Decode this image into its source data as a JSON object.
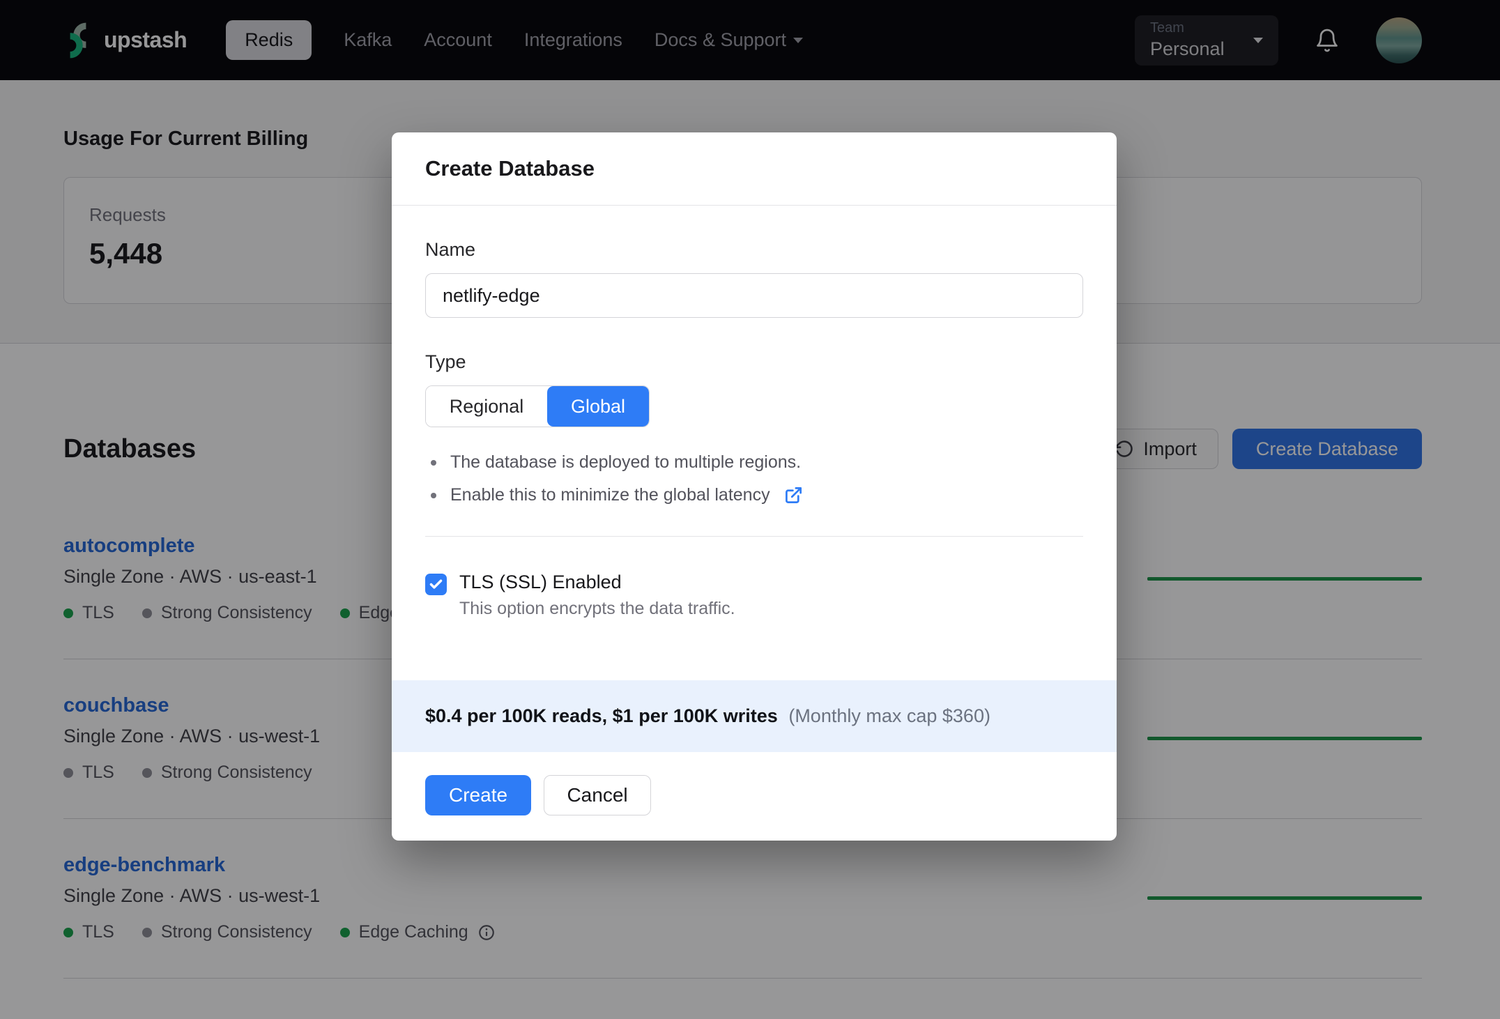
{
  "nav": {
    "brand": "upstash",
    "items": [
      {
        "label": "Redis"
      },
      {
        "label": "Kafka"
      },
      {
        "label": "Account"
      },
      {
        "label": "Integrations"
      },
      {
        "label": "Docs & Support"
      }
    ],
    "team": {
      "label": "Team",
      "value": "Personal"
    }
  },
  "billing": {
    "heading": "Usage For Current Billing",
    "requests_label": "Requests",
    "requests_value": "5,448"
  },
  "databases": {
    "heading": "Databases",
    "import_label": "Import",
    "create_label": "Create Database",
    "rows": [
      {
        "name": "autocomplete",
        "meta": "Single Zone · AWS · us-east-1",
        "badges": [
          {
            "label": "TLS",
            "state": "on"
          },
          {
            "label": "Strong Consistency",
            "state": "off"
          },
          {
            "label": "Edge Caching",
            "state": "on"
          }
        ]
      },
      {
        "name": "couchbase",
        "meta": "Single Zone · AWS · us-west-1",
        "badges": [
          {
            "label": "TLS",
            "state": "off"
          },
          {
            "label": "Strong Consistency",
            "state": "off"
          }
        ]
      },
      {
        "name": "edge-benchmark",
        "meta": "Single Zone · AWS · us-west-1",
        "badges": [
          {
            "label": "TLS",
            "state": "on"
          },
          {
            "label": "Strong Consistency",
            "state": "off"
          },
          {
            "label": "Edge Caching",
            "state": "on"
          }
        ]
      }
    ]
  },
  "modal": {
    "title": "Create Database",
    "name_label": "Name",
    "name_value": "netlify-edge",
    "type_label": "Type",
    "type_options": [
      {
        "label": "Regional"
      },
      {
        "label": "Global"
      }
    ],
    "type_selected": "Global",
    "bullets": [
      "The database is deployed to multiple regions.",
      "Enable this to minimize the global latency"
    ],
    "tls_label": "TLS (SSL) Enabled",
    "tls_desc": "This option encrypts the data traffic.",
    "pricing_bold": "$0.4 per 100K reads, $1 per 100K writes",
    "pricing_muted": "(Monthly max cap $360)",
    "create_label": "Create",
    "cancel_label": "Cancel"
  },
  "colors": {
    "accent_blue": "#2e7cf6",
    "status_green": "#18a34a",
    "status_gray": "#8e8e96",
    "banner_bg": "#e9f1fd"
  }
}
